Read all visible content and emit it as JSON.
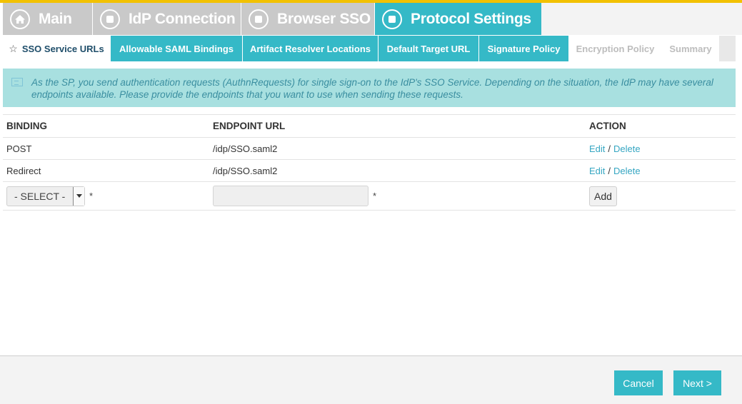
{
  "main_tabs": [
    {
      "label": "Main",
      "icon": "home-icon",
      "active": false
    },
    {
      "label": "IdP Connection",
      "icon": "step-icon",
      "active": false
    },
    {
      "label": "Browser SSO",
      "icon": "step-icon",
      "active": false
    },
    {
      "label": "Protocol Settings",
      "icon": "step-icon",
      "active": true
    }
  ],
  "sub_tabs": [
    {
      "label": "SSO Service URLs",
      "state": "current",
      "icon": "star-icon"
    },
    {
      "label": "Allowable SAML Bindings",
      "state": "enabled"
    },
    {
      "label": "Artifact Resolver Locations",
      "state": "enabled"
    },
    {
      "label": "Default Target URL",
      "state": "enabled"
    },
    {
      "label": "Signature Policy",
      "state": "enabled"
    },
    {
      "label": "Encryption Policy",
      "state": "disabled"
    },
    {
      "label": "Summary",
      "state": "disabled"
    }
  ],
  "info": {
    "icon": "info-icon",
    "text": "As the SP, you send authentication requests (AuthnRequests) for single sign-on to the IdP's SSO Service. Depending on the situation, the IdP may have several endpoints available. Please provide the endpoints that you want to use when sending these requests."
  },
  "table": {
    "headers": {
      "binding": "BINDING",
      "endpoint": "ENDPOINT URL",
      "action": "ACTION"
    },
    "rows": [
      {
        "binding": "POST",
        "endpoint": "/idp/SSO.saml2",
        "edit": "Edit",
        "separator": "/",
        "delete": "Delete"
      },
      {
        "binding": "Redirect",
        "endpoint": "/idp/SSO.saml2",
        "edit": "Edit",
        "separator": "/",
        "delete": "Delete"
      }
    ],
    "new_row": {
      "binding_select": "- SELECT -",
      "required_mark": "*",
      "endpoint_value": "",
      "add_label": "Add"
    }
  },
  "footer": {
    "cancel_label": "Cancel",
    "next_label": "Next >"
  },
  "colors": {
    "accent": "#35b9c7",
    "top_bar": "#f2c100",
    "info_bg": "#a8e0e0",
    "inactive_tab": "#c9c9c9"
  }
}
